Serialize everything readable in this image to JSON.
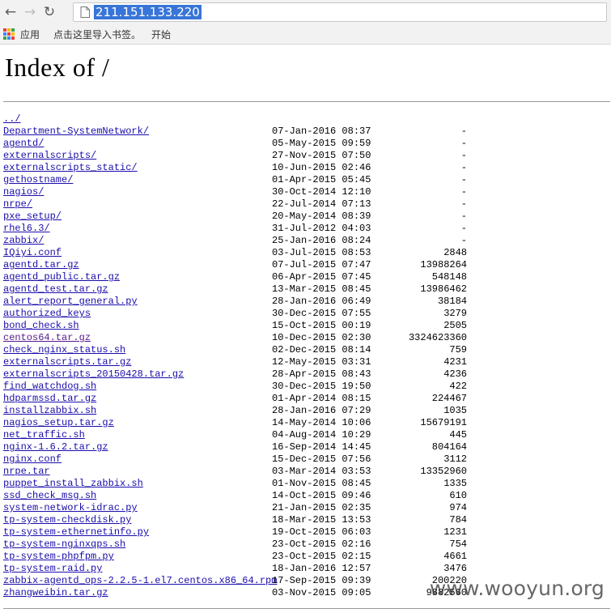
{
  "browser": {
    "url": "211.151.133.220",
    "back_icon": "back-arrow-icon",
    "forward_icon": "forward-arrow-icon",
    "reload_icon": "reload-icon"
  },
  "bookmarks": {
    "apps_label": "应用",
    "import_label": "点击这里导入书签。",
    "start_label": "开始"
  },
  "page": {
    "title": "Index of /",
    "parent_link": "../"
  },
  "entries": [
    {
      "name": "Department-SystemNetwork/",
      "date": "07-Jan-2016 08:37",
      "size": "-"
    },
    {
      "name": "agentd/",
      "date": "05-May-2015 09:59",
      "size": "-"
    },
    {
      "name": "externalscripts/",
      "date": "27-Nov-2015 07:50",
      "size": "-"
    },
    {
      "name": "externalscripts_static/",
      "date": "10-Jun-2015 02:46",
      "size": "-"
    },
    {
      "name": "gethostname/",
      "date": "01-Apr-2015 05:45",
      "size": "-"
    },
    {
      "name": "nagios/",
      "date": "30-Oct-2014 12:10",
      "size": "-"
    },
    {
      "name": "nrpe/",
      "date": "22-Jul-2014 07:13",
      "size": "-"
    },
    {
      "name": "pxe_setup/",
      "date": "20-May-2014 08:39",
      "size": "-"
    },
    {
      "name": "rhel6.3/",
      "date": "31-Jul-2012 04:03",
      "size": "-"
    },
    {
      "name": "zabbix/",
      "date": "25-Jan-2016 08:24",
      "size": "-"
    },
    {
      "name": "IQiyi.conf",
      "date": "03-Jul-2015 08:53",
      "size": "2848"
    },
    {
      "name": "agentd.tar.gz",
      "date": "07-Jul-2015 07:47",
      "size": "13988264"
    },
    {
      "name": "agentd_public.tar.gz",
      "date": "06-Apr-2015 07:45",
      "size": "548148"
    },
    {
      "name": "agentd_test.tar.gz",
      "date": "13-Mar-2015 08:45",
      "size": "13986462"
    },
    {
      "name": "alert_report_general.py",
      "date": "28-Jan-2016 06:49",
      "size": "38184"
    },
    {
      "name": "authorized_keys",
      "date": "30-Dec-2015 07:55",
      "size": "3279"
    },
    {
      "name": "bond_check.sh",
      "date": "15-Oct-2015 00:19",
      "size": "2505"
    },
    {
      "name": "centos64.tar.gz",
      "date": "10-Dec-2015 02:30",
      "size": "3324623360"
    },
    {
      "name": "check_nginx_status.sh",
      "date": "02-Dec-2015 08:14",
      "size": "759"
    },
    {
      "name": "externalscripts.tar.gz",
      "date": "12-May-2015 03:31",
      "size": "4231"
    },
    {
      "name": "externalscripts_20150428.tar.gz",
      "date": "28-Apr-2015 08:43",
      "size": "4236"
    },
    {
      "name": "find_watchdog.sh",
      "date": "30-Dec-2015 19:50",
      "size": "422"
    },
    {
      "name": "hdparmssd.tar.gz",
      "date": "01-Apr-2014 08:15",
      "size": "224467"
    },
    {
      "name": "installzabbix.sh",
      "date": "28-Jan-2016 07:29",
      "size": "1035"
    },
    {
      "name": "nagios_setup.tar.gz",
      "date": "14-May-2014 10:06",
      "size": "15679191"
    },
    {
      "name": "net_traffic.sh",
      "date": "04-Aug-2014 10:29",
      "size": "445"
    },
    {
      "name": "nginx-1.6.2.tar.gz",
      "date": "16-Sep-2014 14:45",
      "size": "804164"
    },
    {
      "name": "nginx.conf",
      "date": "15-Dec-2015 07:56",
      "size": "3112"
    },
    {
      "name": "nrpe.tar",
      "date": "03-Mar-2014 03:53",
      "size": "13352960"
    },
    {
      "name": "puppet_install_zabbix.sh",
      "date": "01-Nov-2015 08:45",
      "size": "1335"
    },
    {
      "name": "ssd_check_msg.sh",
      "date": "14-Oct-2015 09:46",
      "size": "610"
    },
    {
      "name": "system-network-idrac.py",
      "date": "21-Jan-2015 02:35",
      "size": "974"
    },
    {
      "name": "tp-system-checkdisk.py",
      "date": "18-Mar-2015 13:53",
      "size": "784"
    },
    {
      "name": "tp-system-ethernetinfo.py",
      "date": "19-Oct-2015 06:03",
      "size": "1231"
    },
    {
      "name": "tp-system-nginxqps.sh",
      "date": "23-Oct-2015 02:16",
      "size": "754"
    },
    {
      "name": "tp-system-phpfpm.py",
      "date": "23-Oct-2015 02:15",
      "size": "4661"
    },
    {
      "name": "tp-system-raid.py",
      "date": "18-Jan-2016 12:57",
      "size": "3476"
    },
    {
      "name": "zabbix-agentd_ops-2.2.5-1.el7.centos.x86_64.rpm",
      "date": "17-Sep-2015 09:39",
      "size": "200220"
    },
    {
      "name": "zhangweibin.tar.gz",
      "date": "03-Nov-2015 09:05",
      "size": "9882560"
    }
  ],
  "watermark": "www.wooyun.org",
  "colors": {
    "link": "#1a0dab",
    "visited": "#551a8b",
    "url_highlight": "#3875d7"
  }
}
